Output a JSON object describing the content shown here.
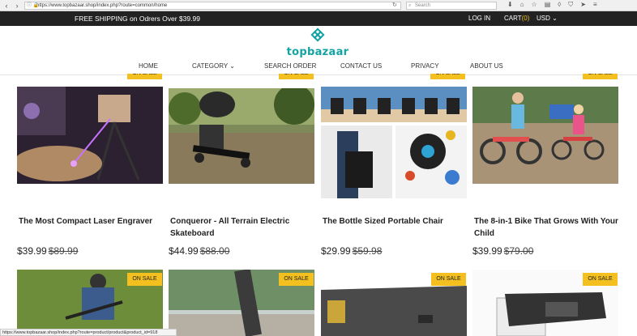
{
  "browser": {
    "url": "https://www.topbazaar.shop/index.php?route=common/home",
    "search_placeholder": "Search"
  },
  "topbar": {
    "promo": "FREE SHIPPING on Odrers Over $39.99",
    "login": "LOG IN",
    "cart_label": "CART",
    "cart_count": "(0)",
    "currency": "USD"
  },
  "logo": {
    "text": "topbazaar",
    "color": "#14a3a3"
  },
  "nav": {
    "home": "HOME",
    "category": "CATEGORY",
    "search_order": "SEARCH ORDER",
    "contact": "CONTACT US",
    "privacy": "PRIVACY",
    "about": "ABOUT US"
  },
  "sale_label": "ON SALE",
  "products": [
    {
      "title": "The Most Compact Laser Engraver",
      "price": "$39.99",
      "old_price": "$89.99"
    },
    {
      "title": "Conqueror - All Terrain Electric Skateboard",
      "price": "$44.99",
      "old_price": "$88.00"
    },
    {
      "title": "The Bottle Sized Portable Chair",
      "price": "$29.99",
      "old_price": "$59.98"
    },
    {
      "title": "The 8-in-1 Bike That Grows With Your Child",
      "price": "$39.99",
      "old_price": "$79.00"
    }
  ],
  "status_bar": "https://www.topbazaar.shop/index.php?route=product/product&product_id=918",
  "colors": {
    "accent_yellow": "#f3c020",
    "topbar_bg": "#222222"
  }
}
